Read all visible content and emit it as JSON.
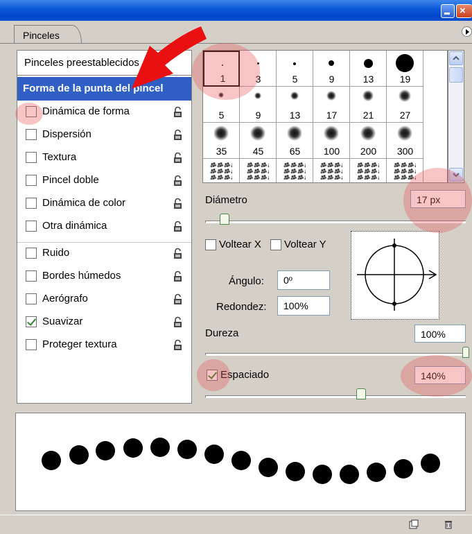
{
  "panel": {
    "tab_label": "Pinceles"
  },
  "left_list": {
    "preset_label": "Pinceles preestablecidos",
    "active_label": "Forma de la punta del pincel",
    "items": [
      {
        "label": "Dinámica de forma",
        "checked": false
      },
      {
        "label": "Dispersión",
        "checked": false
      },
      {
        "label": "Textura",
        "checked": false
      },
      {
        "label": "Pincel doble",
        "checked": false
      },
      {
        "label": "Dinámica de color",
        "checked": false
      },
      {
        "label": "Otra dinámica",
        "checked": false
      },
      {
        "label": "Ruido",
        "checked": false
      },
      {
        "label": "Bordes húmedos",
        "checked": false
      },
      {
        "label": "Aerógrafo",
        "checked": false
      },
      {
        "label": "Suavizar",
        "checked": true
      },
      {
        "label": "Proteger textura",
        "checked": false
      }
    ]
  },
  "brush_grid": {
    "row1": [
      "1",
      "3",
      "5",
      "9",
      "13",
      "19"
    ],
    "row2": [
      "5",
      "9",
      "13",
      "17",
      "21",
      "27"
    ],
    "row3": [
      "35",
      "45",
      "65",
      "100",
      "200",
      "300"
    ],
    "selected": "1"
  },
  "controls": {
    "diameter_label": "Diámetro",
    "diameter_value": "17 px",
    "flip_x_label": "Voltear X",
    "flip_y_label": "Voltear Y",
    "angle_label": "Ángulo:",
    "angle_value": "0º",
    "roundness_label": "Redondez:",
    "roundness_value": "100%",
    "hardness_label": "Dureza",
    "hardness_value": "100%",
    "spacing_label": "Espaciado",
    "spacing_value": "140%",
    "spacing_checked": true
  },
  "colors": {
    "titlebar": "#0a57d8",
    "selection": "#2f5fc4",
    "highlight": "#e85a5a",
    "arrow": "#e81010"
  },
  "icons": {
    "lock": "lock-icon",
    "new_preset": "new-brush-icon",
    "delete": "trash-icon"
  }
}
